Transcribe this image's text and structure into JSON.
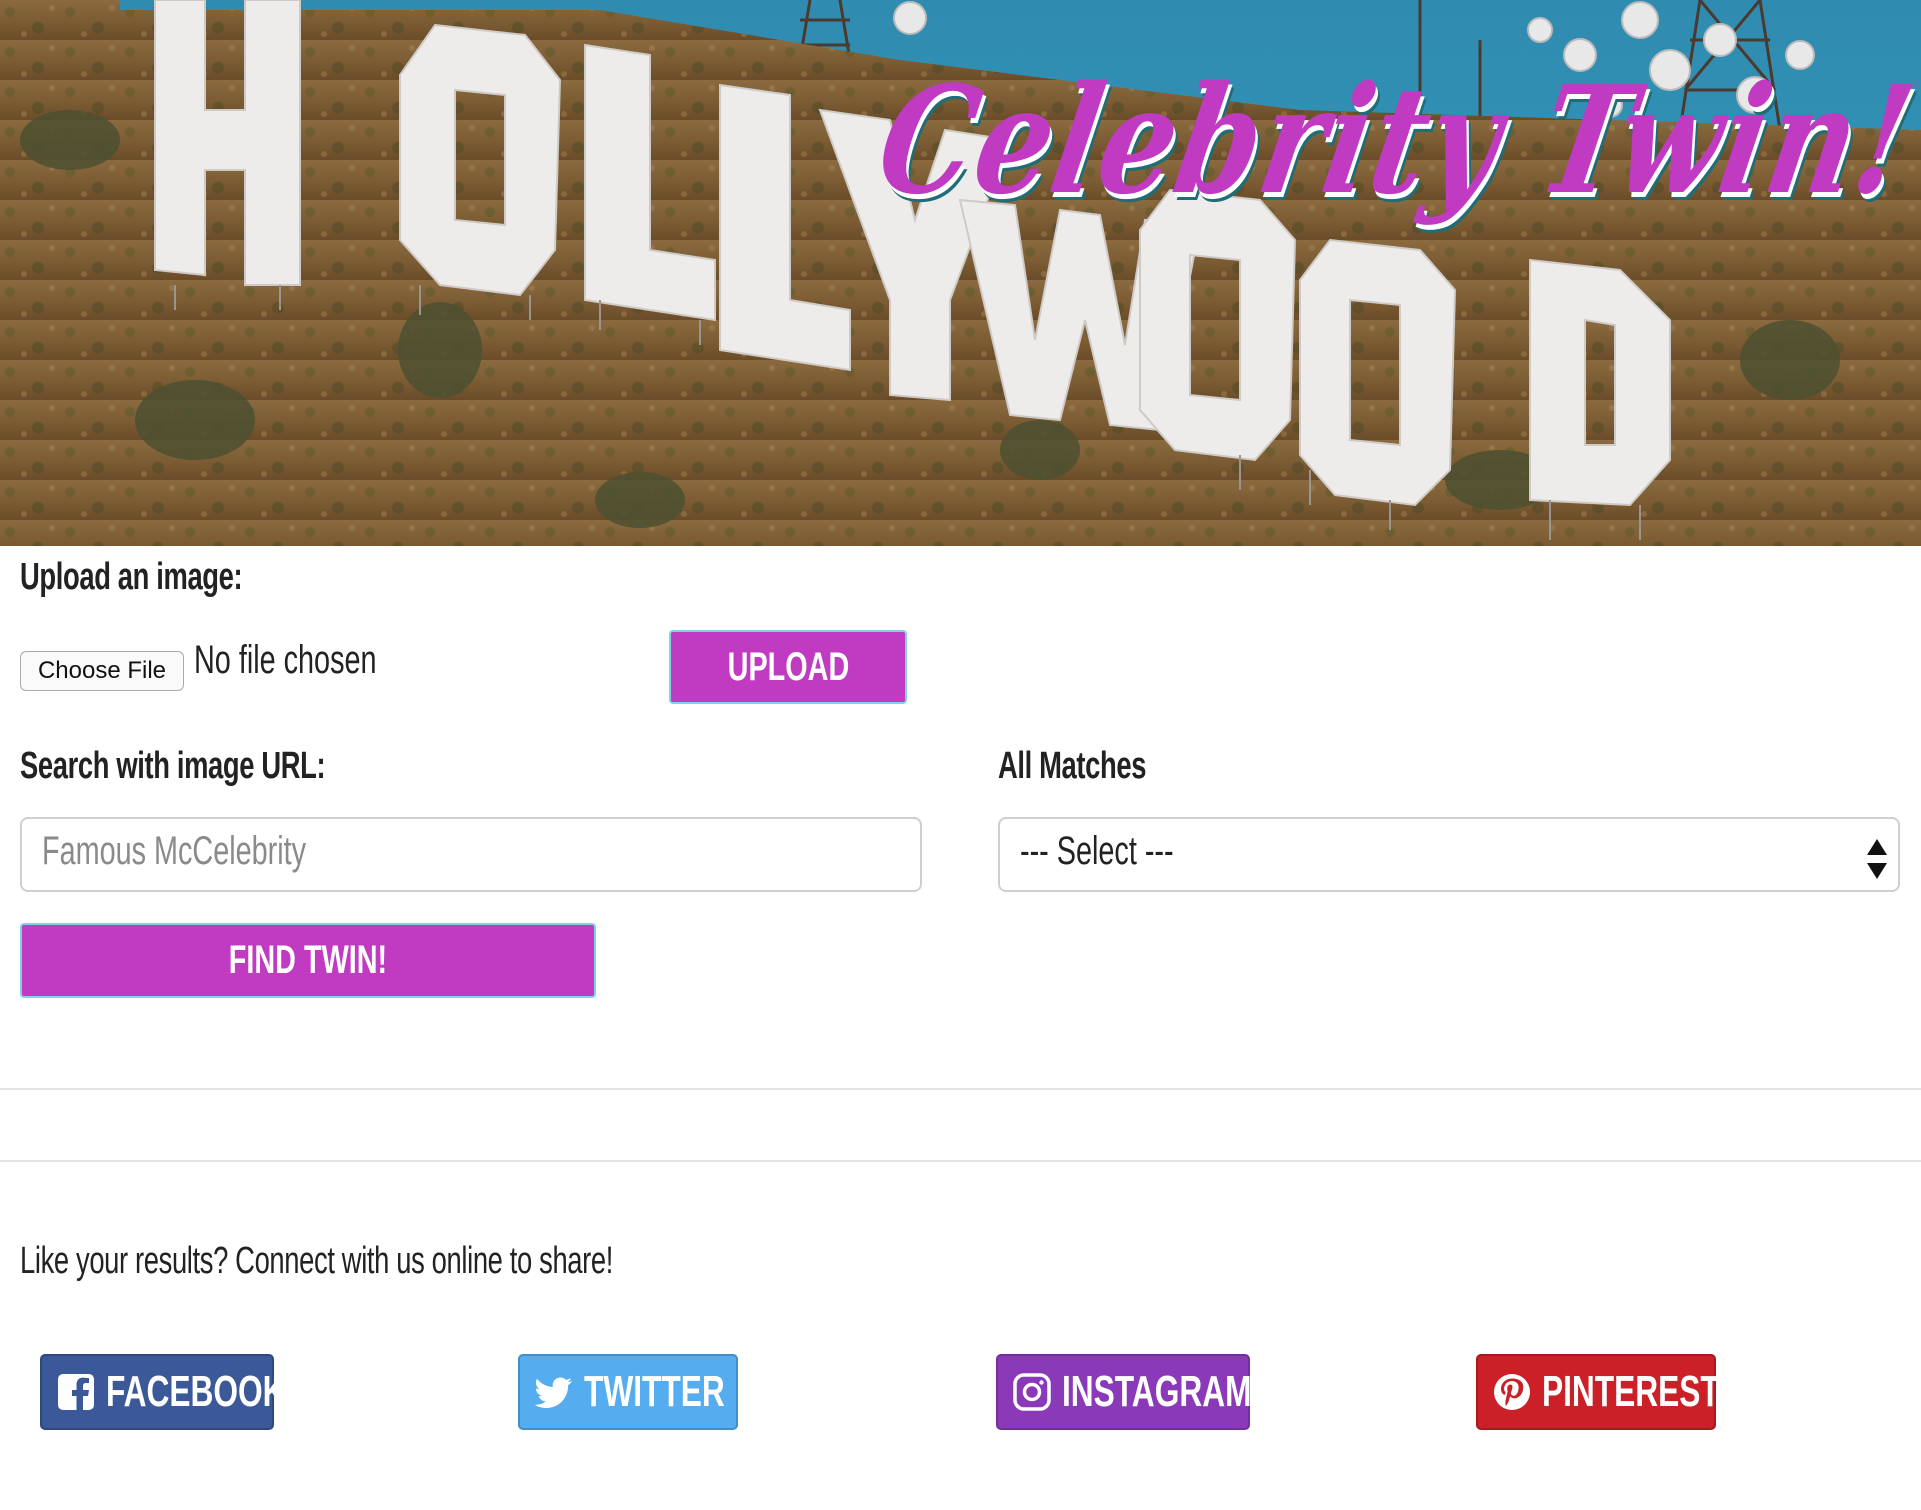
{
  "hero": {
    "title": "Celebrity Twin!",
    "accent_color": "#c03bc2",
    "sign_letters": [
      "H",
      "O",
      "L",
      "L",
      "Y",
      "W",
      "O",
      "O",
      "D"
    ]
  },
  "upload": {
    "label": "Upload an image:",
    "choose_file_label": "Choose File",
    "file_status": "No file chosen",
    "button_label": "UPLOAD"
  },
  "search": {
    "label": "Search with image URL:",
    "placeholder": "Famous McCelebrity",
    "button_label": "FIND TWIN!"
  },
  "matches": {
    "label": "All Matches",
    "selected_value": "--- Select ---"
  },
  "share": {
    "text": "Like your results? Connect with us online to share!",
    "buttons": [
      {
        "label": "FACEBOOK",
        "icon": "facebook-icon",
        "color": "#3b5998"
      },
      {
        "label": "TWITTER",
        "icon": "twitter-icon",
        "color": "#55acee"
      },
      {
        "label": "INSTAGRAM",
        "icon": "instagram-icon",
        "color": "#8a3ab9"
      },
      {
        "label": "PINTEREST",
        "icon": "pinterest-icon",
        "color": "#cb2027"
      }
    ]
  }
}
